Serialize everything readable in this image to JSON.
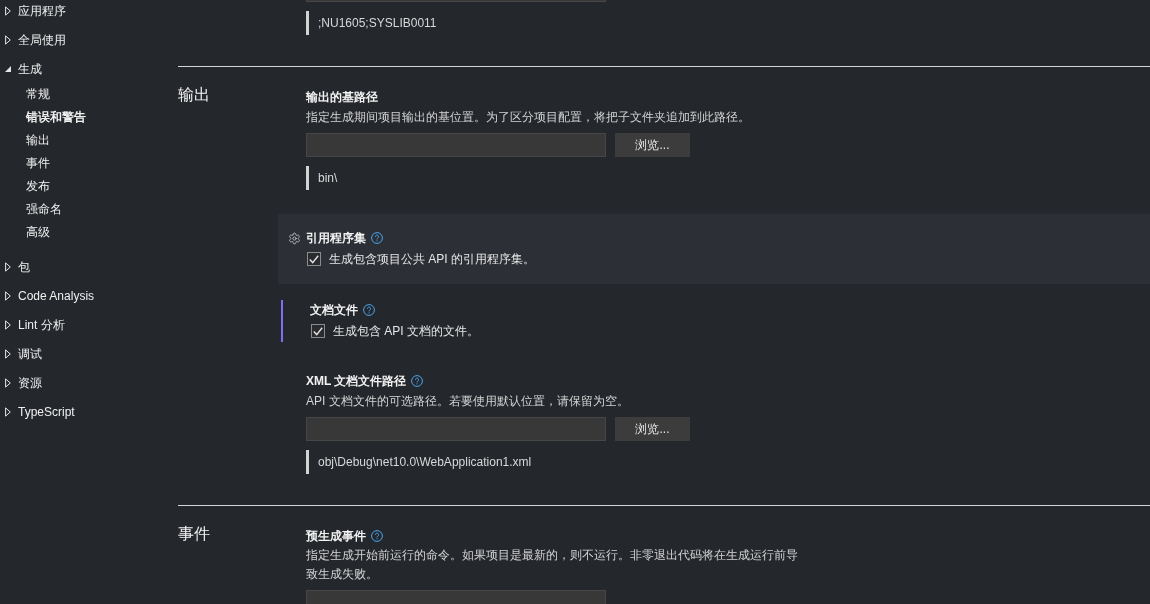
{
  "sidebar": {
    "items": [
      {
        "label": "应用程序",
        "expanded": false,
        "selected": false
      },
      {
        "label": "全局使用",
        "expanded": false,
        "selected": false
      },
      {
        "label": "生成",
        "expanded": true,
        "selected": false,
        "children": [
          {
            "label": "常规",
            "selected": false
          },
          {
            "label": "错误和警告",
            "selected": true
          },
          {
            "label": "输出",
            "selected": false
          },
          {
            "label": "事件",
            "selected": false
          },
          {
            "label": "发布",
            "selected": false
          },
          {
            "label": "强命名",
            "selected": false
          },
          {
            "label": "高级",
            "selected": false
          }
        ]
      },
      {
        "label": "包",
        "expanded": false,
        "selected": false
      },
      {
        "label": "Code Analysis",
        "expanded": false,
        "selected": false
      },
      {
        "label": "Lint 分析",
        "expanded": false,
        "selected": false
      },
      {
        "label": "调试",
        "expanded": false,
        "selected": false
      },
      {
        "label": "资源",
        "expanded": false,
        "selected": false
      },
      {
        "label": "TypeScript",
        "expanded": false,
        "selected": false
      }
    ]
  },
  "partial_setting": {
    "evaluated_value": ";NU1605;SYSLIB0011"
  },
  "sections": [
    {
      "heading": "输出",
      "settings": [
        {
          "kind": "path",
          "title": "输出的基路径",
          "help": false,
          "hovered": false,
          "highlighted": false,
          "description": "指定生成期间项目输出的基位置。为了区分项目配置，将把子文件夹追加到此路径。",
          "browse_button": "浏览...",
          "evaluated_value": "bin\\"
        },
        {
          "kind": "checkbox",
          "title": "引用程序集",
          "help": true,
          "hovered": true,
          "highlighted": false,
          "checkbox": {
            "label": "生成包含项目公共 API 的引用程序集。",
            "checked": true
          }
        },
        {
          "kind": "checkbox",
          "title": "文档文件",
          "help": true,
          "hovered": false,
          "highlighted": true,
          "checkbox": {
            "label": "生成包含 API 文档的文件。",
            "checked": true
          }
        },
        {
          "kind": "path",
          "title": "XML 文档文件路径",
          "help": true,
          "hovered": false,
          "highlighted": false,
          "description": "API 文档文件的可选路径。若要使用默认位置，请保留为空。",
          "browse_button": "浏览...",
          "evaluated_value": "obj\\Debug\\net10.0\\WebApplication1.xml"
        }
      ]
    },
    {
      "heading": "事件",
      "settings": [
        {
          "kind": "command",
          "title": "预生成事件",
          "help": true,
          "hovered": false,
          "highlighted": false,
          "description": "指定生成开始前运行的命令。如果项目是最新的，则不运行。非零退出代码将在生成运行前导致生成失败。"
        }
      ]
    }
  ]
}
